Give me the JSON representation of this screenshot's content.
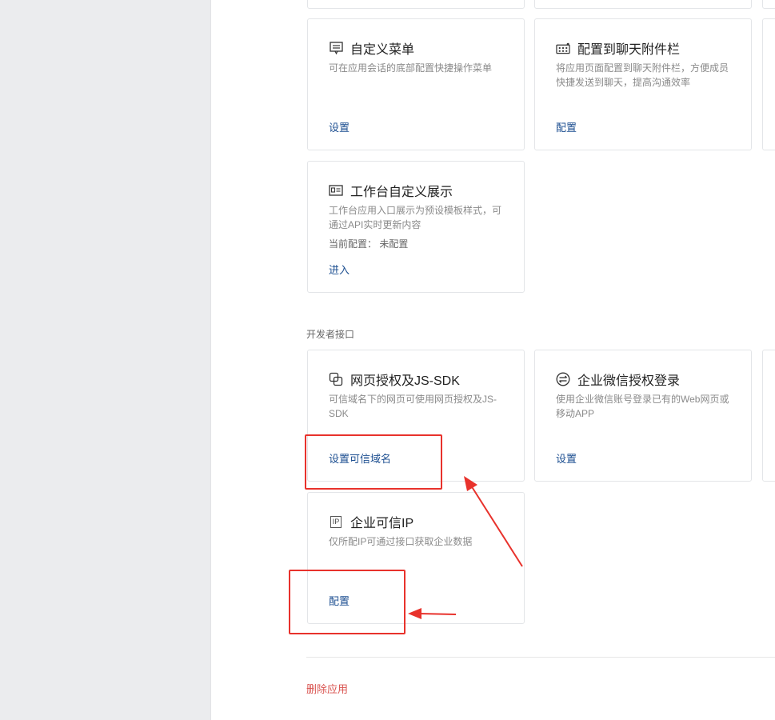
{
  "cards": {
    "custom_menu": {
      "title": "自定义菜单",
      "icon": "menu-icon",
      "desc": "可在应用会话的底部配置快捷操作菜单",
      "action": "设置"
    },
    "chat_attachment": {
      "title": "配置到聊天附件栏",
      "icon": "keyboard-icon",
      "desc": "将应用页面配置到聊天附件栏，方便成员快捷发送到聊天，提高沟通效率",
      "action": "配置"
    },
    "workbench_display": {
      "title": "工作台自定义展示",
      "icon": "card-display-icon",
      "desc": "工作台应用入口展示为预设模板样式，可通过API实时更新内容",
      "status": "当前配置： 未配置",
      "action": "进入"
    },
    "web_auth_jssdk": {
      "title": "网页授权及JS-SDK",
      "icon": "link-squares-icon",
      "desc": "可信域名下的网页可使用网页授权及JS-SDK",
      "action": "设置可信域名"
    },
    "wecom_login": {
      "title": "企业微信授权登录",
      "icon": "login-icon",
      "desc": "使用企业微信账号登录已有的Web网页或移动APP",
      "action": "设置"
    },
    "trusted_ip": {
      "title": "企业可信IP",
      "icon": "ip-icon",
      "icon_text": "IP",
      "desc": "仅所配IP可通过接口获取企业数据",
      "action": "配置"
    }
  },
  "section": {
    "developer_api": "开发者接口"
  },
  "footer": {
    "delete_app": "删除应用"
  },
  "colors": {
    "link": "#1d4f91",
    "danger": "#d9534f",
    "highlight": "#e8322c",
    "sidebar_bg": "#ebecee"
  }
}
